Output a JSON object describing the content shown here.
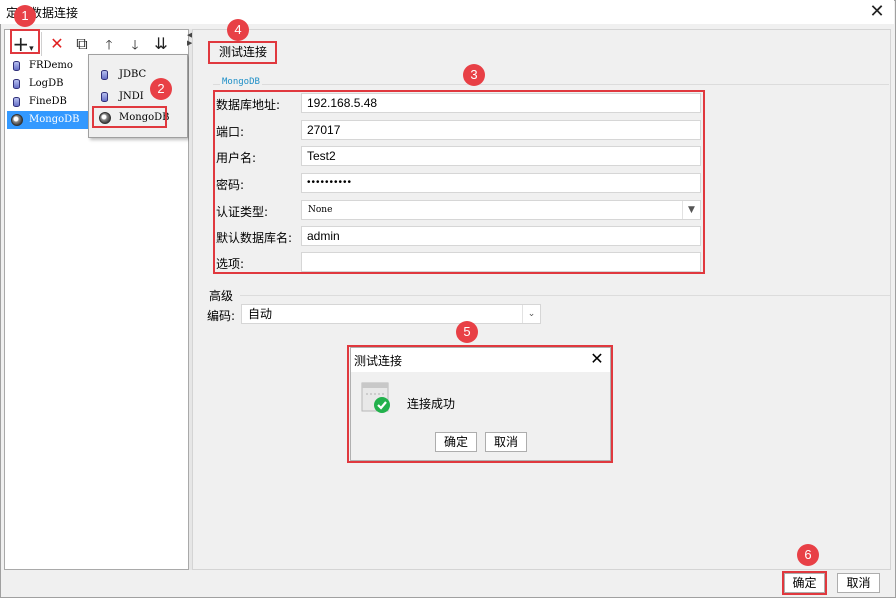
{
  "window": {
    "title": "定义数据连接",
    "close_glyph": "✕"
  },
  "toolbar": {
    "add_glyph": "+",
    "dropdown_glyph": "▾",
    "delete_glyph": "✕",
    "copy_glyph": "⧉",
    "up_glyph": "🡑",
    "down_glyph": "🡓",
    "sort_glyph": "⇊"
  },
  "connections": [
    {
      "label": "FRDemo",
      "icon": "database-icon",
      "selected": false
    },
    {
      "label": "LogDB",
      "icon": "database-icon",
      "selected": false
    },
    {
      "label": "FineDB",
      "icon": "database-icon",
      "selected": false
    },
    {
      "label": "MongoDB",
      "icon": "mongodb-icon",
      "selected": true
    }
  ],
  "add_menu": {
    "items": [
      {
        "label": "JDBC",
        "icon": "database-icon"
      },
      {
        "label": "JNDI",
        "icon": "database-icon"
      },
      {
        "label": "MongoDB",
        "icon": "mongodb-icon"
      }
    ]
  },
  "test_connection_label": "测试连接",
  "form": {
    "group_title": "MongoDB",
    "host_label": "数据库地址:",
    "host_value": "192.168.5.48",
    "port_label": "端口:",
    "port_value": "27017",
    "user_label": "用户名:",
    "user_value": "Test2",
    "password_label": "密码:",
    "password_value": "••••••••••",
    "auth_label": "认证类型:",
    "auth_value": "None",
    "default_db_label": "默认数据库名:",
    "default_db_value": "admin",
    "options_label": "选项:",
    "options_value": ""
  },
  "advanced": {
    "title": "高级",
    "encoding_label": "编码:",
    "encoding_value": "自动"
  },
  "dialog": {
    "title": "测试连接",
    "close_glyph": "✕",
    "message": "连接成功",
    "ok_label": "确定",
    "cancel_label": "取消"
  },
  "footer": {
    "ok_label": "确定",
    "cancel_label": "取消"
  },
  "annotations": [
    "1",
    "2",
    "3",
    "4",
    "5",
    "6"
  ],
  "colors": {
    "annotation": "#e84046",
    "selection": "#3399ff",
    "group_title": "#1e8fc7",
    "success": "#22b14c"
  }
}
